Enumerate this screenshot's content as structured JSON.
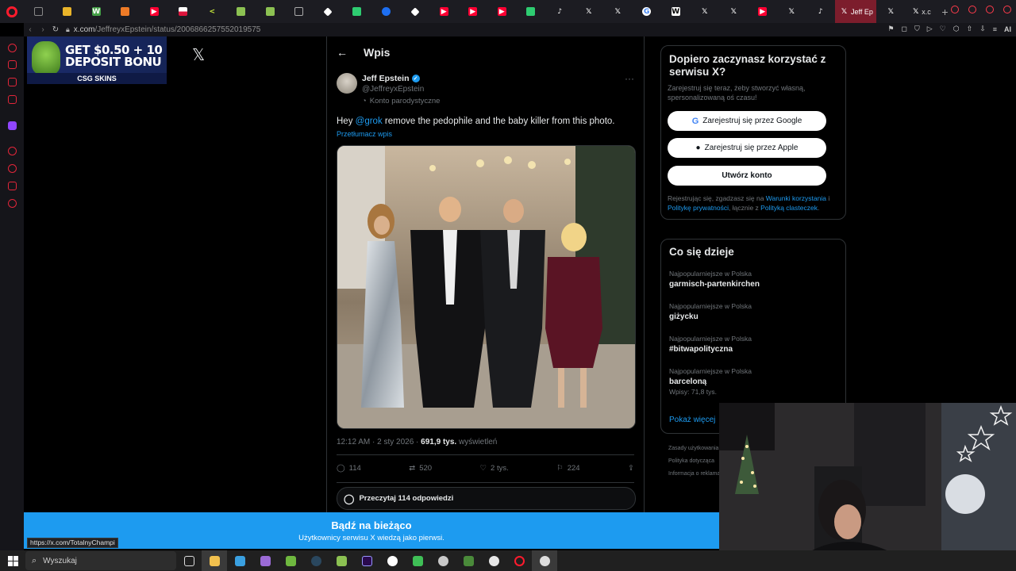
{
  "browser": {
    "url_host": "x.com",
    "url_path": "/JeffreyxEpstein/status/2006866257552019575",
    "active_tab_label": "Jeff Ep",
    "tab_x_label": "x.c",
    "ai_label": "AI"
  },
  "ad": {
    "line1": "GET $0.50 + 10",
    "line2": "DEPOSIT BONU",
    "brand": "CSG SKINS"
  },
  "post_page": {
    "back_label": "←",
    "title": "Wpis",
    "author": {
      "name": "Jeff Epstein",
      "handle": "@JeffreyxEpstein",
      "label": "Konto parodystyczne"
    },
    "text_before": "Hey ",
    "mention": "@grok",
    "text_after": " remove the pedophile and the baby killer from this photo.",
    "translate": "Przetłumacz wpis",
    "time": "12:12 AM · 2 sty 2026 · ",
    "views": "691,9 tys.",
    "views_label": " wyświetleń",
    "replies": "114",
    "reposts": "520",
    "likes": "2 tys.",
    "bookmarks": "224",
    "read_replies": "Przeczytaj 114 odpowiedzi"
  },
  "signup": {
    "title": "Dopiero zaczynasz korzystać z serwisu X?",
    "subtitle": "Zarejestruj się teraz, żeby stworzyć własną, spersonalizowaną oś czasu!",
    "google": "Zarejestruj się przez Google",
    "apple": "Zarejestruj się przez Apple",
    "create": "Utwórz konto",
    "legal_1": "Rejestrując się, zgadzasz się na ",
    "legal_terms": "Warunki korzystania",
    "legal_2": " i ",
    "legal_privacy": "Politykę prywatności",
    "legal_3": ", łącznie z ",
    "legal_cookies": "Polityką clasteczek",
    "legal_4": "."
  },
  "trends": {
    "title": "Co się dzieje",
    "items": [
      {
        "context": "Najpopularniejsze w Polska",
        "name": "garmisch-partenkirchen",
        "posts": ""
      },
      {
        "context": "Najpopularniejsze w Polska",
        "name": "giżycku",
        "posts": ""
      },
      {
        "context": "Najpopularniejsze w Polska",
        "name": "#bitwapolityczna",
        "posts": ""
      },
      {
        "context": "Najpopularniejsze w Polska",
        "name": "barceloną",
        "posts": "Wpisy: 71,8 tys."
      }
    ],
    "show_more": "Pokaż więcej"
  },
  "footer": {
    "l1": "Zasady użytkowania",
    "l2": "Polityka dotycząca",
    "l3": "Informacja o reklamach"
  },
  "banner": {
    "title": "Bądź na bieżąco",
    "subtitle": "Użytkownicy serwisu X wiedzą jako pierwsi."
  },
  "status_url": "https://x.com/TotalnyChampi",
  "taskbar": {
    "search_placeholder": "Wyszukaj"
  },
  "colors": {
    "x_blue": "#1d9bf0",
    "opera_red": "#ff1b2d",
    "border": "#2f3336"
  }
}
